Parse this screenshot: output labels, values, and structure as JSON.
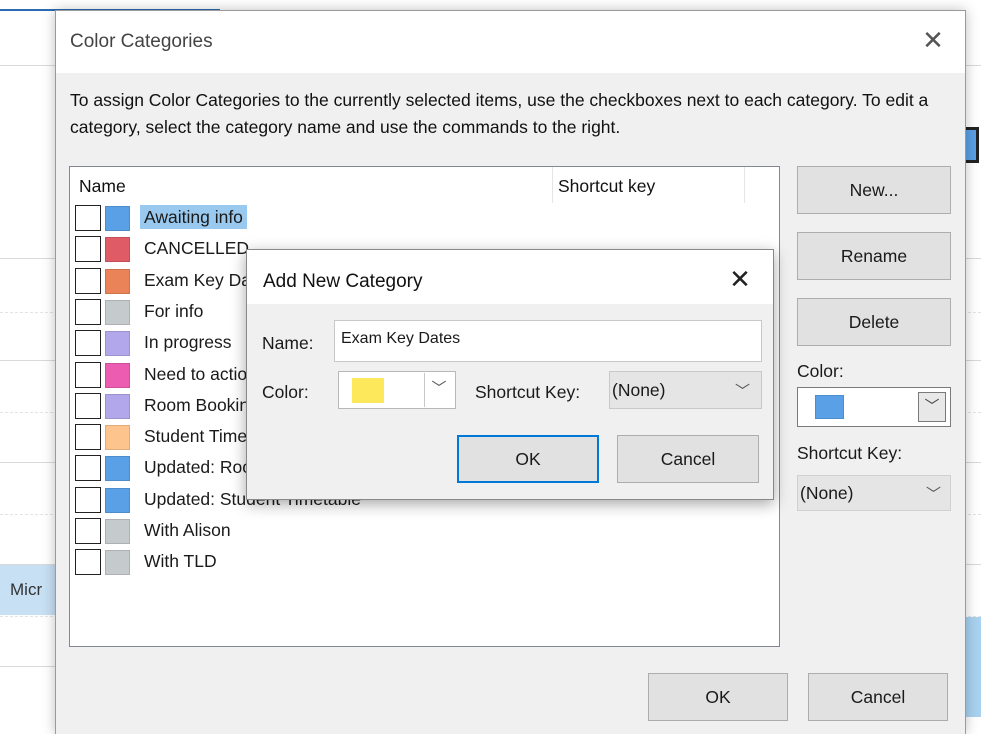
{
  "background": {
    "left_tag": "Micr"
  },
  "dialog": {
    "title": "Color Categories",
    "close_glyph": "✕",
    "instructions": "To assign Color Categories to the currently selected items, use the checkboxes next to each category.  To edit a category, select the category name and use the commands to the right.",
    "columns": {
      "name": "Name",
      "shortcut": "Shortcut key"
    },
    "categories": [
      {
        "label": "Awaiting info",
        "color": "#5aa0e6",
        "checked": false,
        "selected": true
      },
      {
        "label": "CANCELLED",
        "color": "#df5b66",
        "checked": false,
        "selected": false
      },
      {
        "label": "Exam Key Dates",
        "color": "#ea8458",
        "checked": false,
        "selected": false
      },
      {
        "label": "For info",
        "color": "#c5cacd",
        "checked": false,
        "selected": false
      },
      {
        "label": "In progress",
        "color": "#b2a7ea",
        "checked": false,
        "selected": false
      },
      {
        "label": "Need to action",
        "color": "#ec5cb0",
        "checked": false,
        "selected": false
      },
      {
        "label": "Room Bookings",
        "color": "#b2a7ea",
        "checked": false,
        "selected": false
      },
      {
        "label": "Student Timetable",
        "color": "#fdc58d",
        "checked": false,
        "selected": false
      },
      {
        "label": "Updated: Room",
        "color": "#5aa0e6",
        "checked": false,
        "selected": false
      },
      {
        "label": "Updated: Student Timetable",
        "color": "#5aa0e6",
        "checked": false,
        "selected": false
      },
      {
        "label": "With Alison",
        "color": "#c5cacd",
        "checked": false,
        "selected": false
      },
      {
        "label": "With TLD",
        "color": "#c5cacd",
        "checked": false,
        "selected": false
      }
    ],
    "buttons": {
      "new": "New...",
      "rename": "Rename",
      "delete": "Delete",
      "ok": "OK",
      "cancel": "Cancel"
    },
    "color_label": "Color:",
    "selected_color": "#5aa0e6",
    "shortcut_label": "Shortcut Key:",
    "shortcut_value": "(None)",
    "dropdown_glyph": "﹀"
  },
  "add_dialog": {
    "title": "Add New Category",
    "close_glyph": "✕",
    "name_label": "Name:",
    "name_value": "Exam Key Dates",
    "color_label": "Color:",
    "color_value": "#fce85a",
    "shortcut_label": "Shortcut Key:",
    "shortcut_value": "(None)",
    "ok": "OK",
    "cancel": "Cancel"
  }
}
